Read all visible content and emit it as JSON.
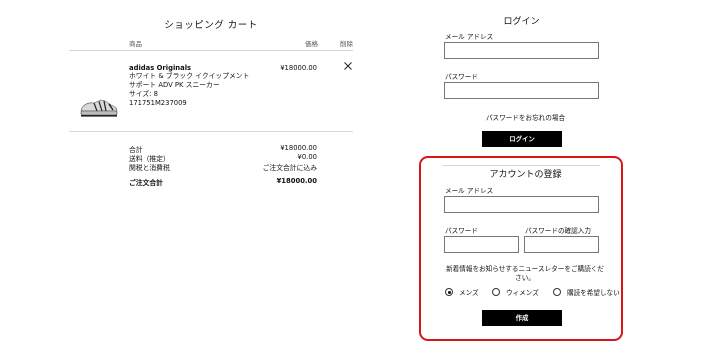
{
  "cart": {
    "title": "ショッピング カート",
    "columns": {
      "product": "商品",
      "price": "価格",
      "remove": "削除"
    },
    "item": {
      "brand": "adidas Originals",
      "lines": [
        "ホワイト & ブラック イクイップメント",
        "サポート ADV PK スニーカー",
        "サイズ: 8",
        "171751M237009"
      ],
      "price": "¥18000.00",
      "remove_icon": "close-icon"
    },
    "summary": [
      {
        "label": "合計",
        "value": "¥18000.00"
      },
      {
        "label": "送料（推定）",
        "value": "¥0.00"
      },
      {
        "label": "関税と消費税",
        "value": "ご注文合計に込み"
      }
    ],
    "order_total": {
      "label": "ご注文合計",
      "value": "¥18000.00"
    }
  },
  "login": {
    "title": "ログイン",
    "email_label": "メール アドレス",
    "email_value": "",
    "password_label": "パスワード",
    "password_value": "",
    "forgot_link": "パスワードをお忘れの場合",
    "submit": "ログイン"
  },
  "register": {
    "title": "アカウントの登録",
    "email_label": "メール アドレス",
    "email_value": "",
    "password_label": "パスワード",
    "password_value": "",
    "confirm_label": "パスワードの確認入力",
    "confirm_value": "",
    "newsletter_text": [
      "新着情報をお知らせするニュースレターをご購読くだ",
      "さい。"
    ],
    "options": [
      {
        "label": "メンズ",
        "selected": true
      },
      {
        "label": "ウィメンズ",
        "selected": false
      },
      {
        "label": "購読を希望しない",
        "selected": false
      }
    ],
    "submit": "作成",
    "highlight_color": "#d9141b"
  }
}
